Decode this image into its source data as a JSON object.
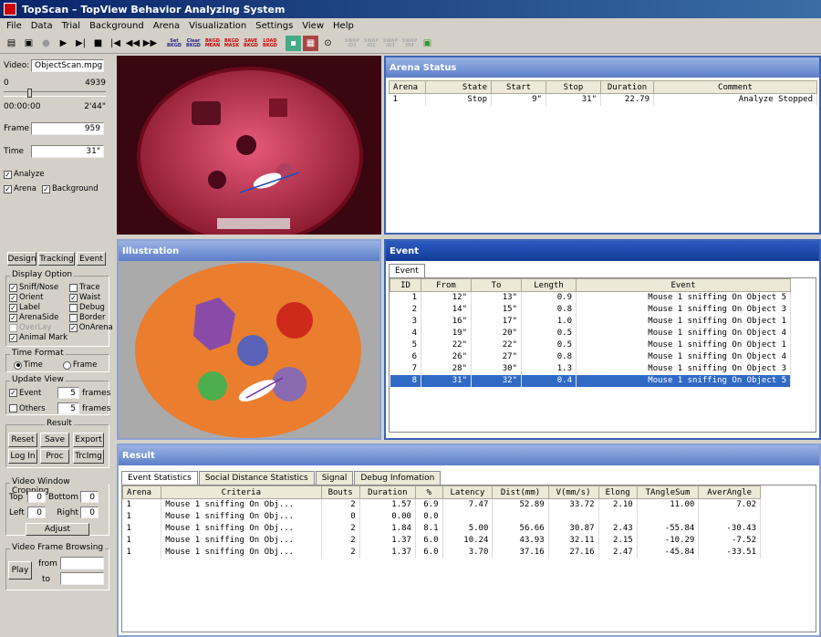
{
  "window": {
    "title": "TopScan – TopView Behavior Analyzing System"
  },
  "menu": [
    "File",
    "Data",
    "Trial",
    "Background",
    "Arena",
    "Visualization",
    "Settings",
    "View",
    "Help"
  ],
  "toolbar": {
    "set_bkgd": "Set\nBKGD",
    "clear_bkgd": "Clear\nBKGD",
    "bkgd_mean": "BKGD\nMEAN",
    "bkgd_mask": "BKGD\nMASK",
    "save_bkgd": "SAVE\nBKGD",
    "load_bkgd": "LOAD\nBKGD",
    "swap1": "SWAP\nID1",
    "swap2": "SWAP\nID2",
    "swap3": "SWAP\nID3",
    "swap4": "SWAP\nID4"
  },
  "left": {
    "video_label": "Video:",
    "video_file": "ObjectScan.mpg",
    "range_start": "0",
    "range_end": "4939",
    "time_start": "00:00:00",
    "time_end": "2'44\"",
    "frame_label": "Frame",
    "frame_value": "959",
    "time_label": "Time",
    "time_value": "31\"",
    "analyze": "Analyze",
    "arena": "Arena",
    "background": "Background",
    "btn_design": "Design",
    "btn_tracking": "Tracking",
    "btn_event": "Event",
    "display_option": "Display Option",
    "opt_sniff": "Sniff/Nose",
    "opt_trace": "Trace",
    "opt_orient": "Orient",
    "opt_waist": "Waist",
    "opt_label": "Label",
    "opt_debug": "Debug",
    "opt_arenaside": "ArenaSide",
    "opt_border": "Border",
    "opt_overlay": "OverLay",
    "opt_onarena": "OnArena",
    "opt_animalmark": "Animal Mark",
    "time_format": "Time Format",
    "tf_time": "Time",
    "tf_frame": "Frame",
    "update_view": "Update View",
    "uv_event": "Event",
    "uv_event_val": "5",
    "uv_others": "Others",
    "uv_others_val": "5",
    "frames": "frames",
    "result": "Result",
    "btn_reset": "Reset",
    "btn_save": "Save",
    "btn_export": "Export",
    "btn_login": "Log In",
    "btn_proc": "Proc",
    "btn_trcimg": "TrcImg",
    "crop": "Video Window Cropping",
    "crop_top": "Top",
    "crop_top_val": "0",
    "crop_bottom": "Bottom",
    "crop_bottom_val": "0",
    "crop_left": "Left",
    "crop_left_val": "0",
    "crop_right": "Right",
    "crop_right_val": "0",
    "btn_adjust": "Adjust",
    "browse": "Video Frame Browsing",
    "btn_play": "Play",
    "from": "from",
    "to": "to"
  },
  "arena_status": {
    "title": "Arena Status",
    "headers": [
      "Arena",
      "State",
      "Start",
      "Stop",
      "Duration",
      "Comment"
    ],
    "rows": [
      [
        "1",
        "Stop",
        "9\"",
        "31\"",
        "22.79",
        "Analyze Stopped"
      ]
    ]
  },
  "illustration": {
    "title": "Illustration"
  },
  "event": {
    "title": "Event",
    "tab": "Event",
    "headers": [
      "ID",
      "From",
      "To",
      "Length",
      "Event"
    ],
    "rows": [
      [
        "1",
        "12\"",
        "13\"",
        "0.9",
        "Mouse 1 sniffing On Object 5"
      ],
      [
        "2",
        "14\"",
        "15\"",
        "0.8",
        "Mouse 1 sniffing On Object 3"
      ],
      [
        "3",
        "16\"",
        "17\"",
        "1.0",
        "Mouse 1 sniffing On Object 1"
      ],
      [
        "4",
        "19\"",
        "20\"",
        "0.5",
        "Mouse 1 sniffing On Object 4"
      ],
      [
        "5",
        "22\"",
        "22\"",
        "0.5",
        "Mouse 1 sniffing On Object 1"
      ],
      [
        "6",
        "26\"",
        "27\"",
        "0.8",
        "Mouse 1 sniffing On Object 4"
      ],
      [
        "7",
        "28\"",
        "30\"",
        "1.3",
        "Mouse 1 sniffing On Object 3"
      ],
      [
        "8",
        "31\"",
        "32\"",
        "0.4",
        "Mouse 1 sniffing On Object 5"
      ]
    ]
  },
  "result": {
    "title": "Result",
    "tabs": [
      "Event Statistics",
      "Social Distance Statistics",
      "Signal",
      "Debug Infomation"
    ],
    "headers": [
      "Arena",
      "Criteria",
      "Bouts",
      "Duration",
      "%",
      "Latency",
      "Dist(mm)",
      "V(mm/s)",
      "Elong",
      "TAngleSum",
      "AverAngle"
    ],
    "rows": [
      [
        "1",
        "Mouse 1 sniffing On Obj...",
        "2",
        "1.57",
        "6.9",
        "7.47",
        "52.89",
        "33.72",
        "2.10",
        "11.00",
        "7.02"
      ],
      [
        "1",
        "Mouse 1 sniffing On Obj...",
        "0",
        "0.00",
        "0.0",
        "",
        "",
        "",
        "",
        "",
        ""
      ],
      [
        "1",
        "Mouse 1 sniffing On Obj...",
        "2",
        "1.84",
        "8.1",
        "5.00",
        "56.66",
        "30.87",
        "2.43",
        "-55.84",
        "-30.43"
      ],
      [
        "1",
        "Mouse 1 sniffing On Obj...",
        "2",
        "1.37",
        "6.0",
        "10.24",
        "43.93",
        "32.11",
        "2.15",
        "-10.29",
        "-7.52"
      ],
      [
        "1",
        "Mouse 1 sniffing On Obj...",
        "2",
        "1.37",
        "6.0",
        "3.70",
        "37.16",
        "27.16",
        "2.47",
        "-45.84",
        "-33.51"
      ]
    ]
  }
}
